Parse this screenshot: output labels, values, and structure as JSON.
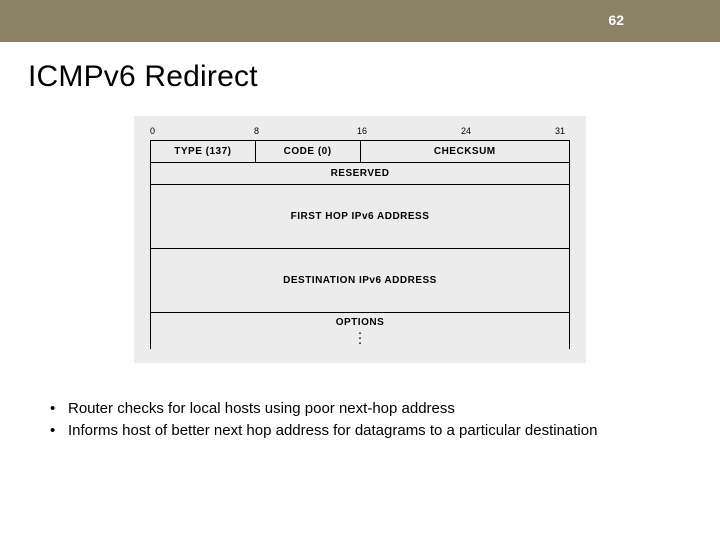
{
  "slide_number": "62",
  "title": "ICMPv6 Redirect",
  "bits": {
    "b0": "0",
    "b8": "8",
    "b16": "16",
    "b24": "24",
    "b31": "31"
  },
  "packet": {
    "type": "TYPE (137)",
    "code": "CODE (0)",
    "checksum": "CHECKSUM",
    "reserved": "RESERVED",
    "first_hop": "FIRST HOP IPv6 ADDRESS",
    "destination": "DESTINATION IPv6 ADDRESS",
    "options": "OPTIONS"
  },
  "bullets": {
    "b1": "Router checks for local hosts using poor next-hop address",
    "b2": "Informs host of better next hop address for datagrams to a particular destination"
  }
}
